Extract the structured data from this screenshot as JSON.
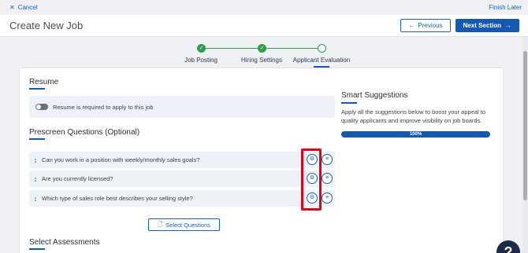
{
  "topbar": {
    "cancel_label": "Cancel",
    "finish_label": "Finish Later"
  },
  "header": {
    "title": "Create New Job",
    "previous_label": "Previous",
    "next_label": "Next Section"
  },
  "steps": [
    {
      "label": "Job Posting",
      "state": "done"
    },
    {
      "label": "Hiring Settings",
      "state": "done"
    },
    {
      "label": "Applicant Evaluation",
      "state": "current"
    }
  ],
  "resume": {
    "title": "Resume",
    "toggle_label": "Resume is required to apply to this job",
    "toggle_on": false
  },
  "prescreen": {
    "title": "Prescreen Questions (Optional)",
    "questions": [
      "Can you work in a position with weekly/monthly sales goals?",
      "Are you currently licensed?",
      "Which type of sales role best describes your selling style?"
    ],
    "select_label": "Select Questions"
  },
  "assessments": {
    "title": "Select Assessments"
  },
  "smart": {
    "title": "Smart Suggestions",
    "description": "Apply all the suggestions below to boost your appeal to quality applicants and improve visibility on job boards.",
    "progress_percent": 100,
    "progress_label": "100%"
  },
  "help": {
    "label": "?"
  },
  "colors": {
    "accent": "#1558b0",
    "success": "#2e9e4a",
    "highlight": "#e2001a"
  }
}
